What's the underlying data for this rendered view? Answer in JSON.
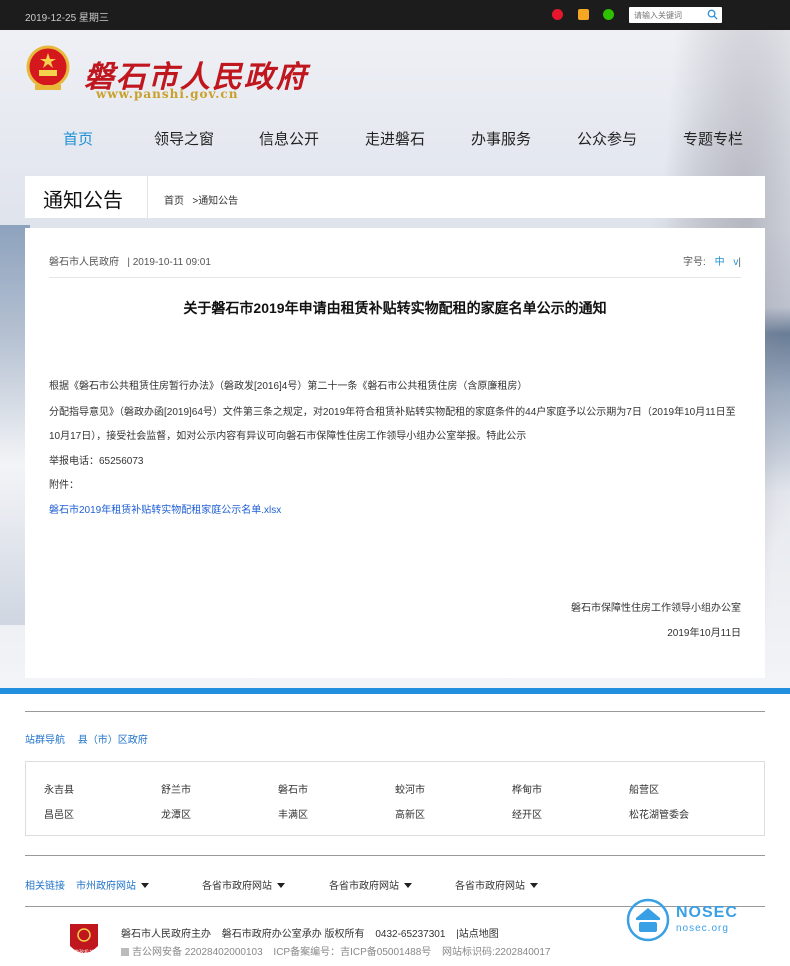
{
  "topbar": {
    "date": "2019-12-25 星期三",
    "search_placeholder": "请输入关键词"
  },
  "header": {
    "site_title": "磐石市人民政府",
    "site_url": "www.panshi.gov.cn"
  },
  "nav": {
    "items": [
      "首页",
      "领导之窗",
      "信息公开",
      "走进磐石",
      "办事服务",
      "公众参与",
      "专题专栏"
    ]
  },
  "section": {
    "title": "通知公告",
    "breadcrumb_home": "首页",
    "breadcrumb_sep": ">",
    "breadcrumb_current": "通知公告"
  },
  "article": {
    "source": "磐石市人民政府",
    "date": "| 2019-10-11 09:01",
    "font_label": "字号:",
    "font_zh": "中",
    "font_v": "v",
    "font_bar": "|",
    "title": "关于磐石市2019年申请由租赁补贴转实物配租的家庭名单公示的通知",
    "paragraphs": [
      "根据《磐石市公共租赁住房暂行办法》（磐政发[2016]4号）第二十一条《磐石市公共租赁住房（含原廉租房）",
      "分配指导意见》（磐政办函[2019]64号）文件第三条之规定，对2019年符合租赁补贴转实物配租的家庭条件的44户家庭予以公示期为7日（2019年10月11日至",
      "10月17日），接受社会监督，如对公示内容有异议可向磐石市保障性住房工作领导小组办公室举报。特此公示",
      "举报电话：65256073",
      "附件："
    ],
    "attachment": "磐石市2019年租赁补贴转实物配租家庭公示名单.xlsx",
    "signer": "磐石市保障性住房工作领导小组办公室",
    "sign_date": "2019年10月11日"
  },
  "footer": {
    "site_nav_label": "站群导航",
    "site_nav_sub": "县（市）区政府",
    "counties": [
      [
        "永吉县",
        "舒兰市",
        "磐石市",
        "蛟河市",
        "桦甸市",
        "船营区"
      ],
      [
        "昌邑区",
        "龙潭区",
        "丰满区",
        "高新区",
        "经开区",
        "松花湖管委会"
      ]
    ],
    "links_label": "相关链接",
    "link_selects": [
      "市州政府网站",
      "各省市政府网站",
      "各省市政府网站",
      "各省市政府网站"
    ],
    "line1": [
      "磐石市人民政府主办",
      "磐石市政府办公室承办 版权所有",
      "0432-65237301",
      "|站点地图"
    ],
    "line2": [
      "吉公网安备 22028402000103",
      "ICP备案编号：吉ICP备05001488号",
      "网站标识码:2202840017"
    ],
    "badge_text": "党政机关",
    "watermark_title": "NOSEC",
    "watermark_sub": "nosec.org"
  },
  "colors": {
    "accent": "#1f8fd6",
    "title_red": "#c0161e",
    "band": "#2290de"
  }
}
